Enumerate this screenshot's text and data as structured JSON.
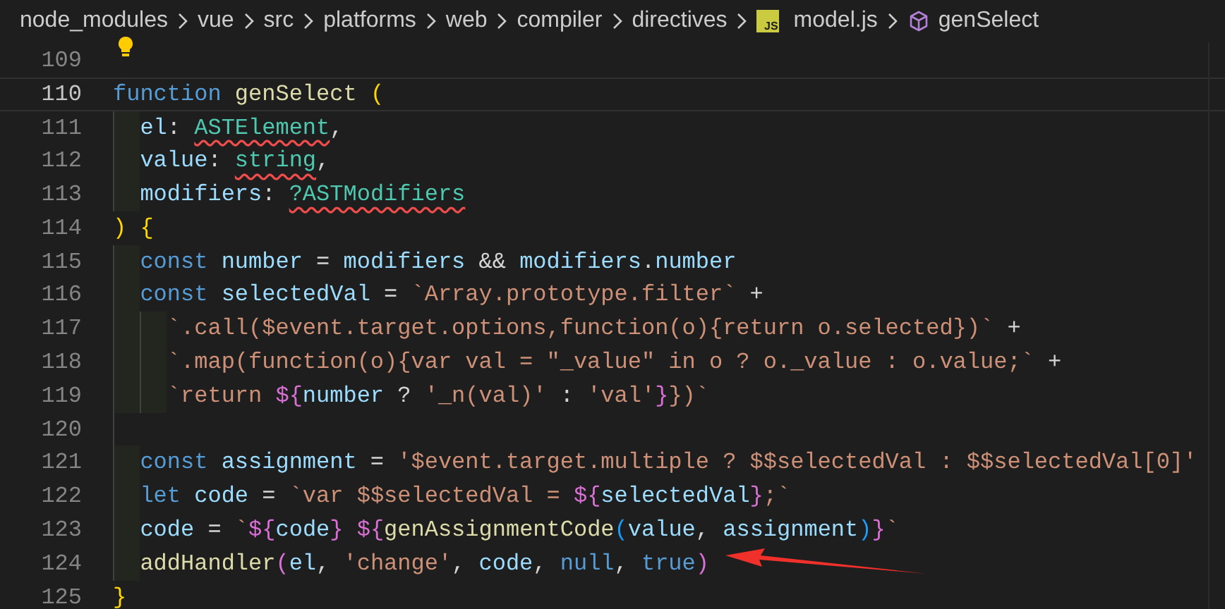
{
  "breadcrumb": [
    {
      "text": "node_modules",
      "kind": "folder"
    },
    {
      "text": "vue",
      "kind": "folder"
    },
    {
      "text": "src",
      "kind": "folder"
    },
    {
      "text": "platforms",
      "kind": "folder"
    },
    {
      "text": "web",
      "kind": "folder"
    },
    {
      "text": "compiler",
      "kind": "folder"
    },
    {
      "text": "directives",
      "kind": "folder"
    },
    {
      "text": "model.js",
      "kind": "file",
      "badge": "JS"
    },
    {
      "text": "genSelect",
      "kind": "symbol"
    }
  ],
  "lines": [
    {
      "number": "109",
      "current": false,
      "lightbulb": true
    },
    {
      "number": "110",
      "current": true,
      "tokens": [
        {
          "text": "function ",
          "kind": "keyword"
        },
        {
          "text": "genSelect ",
          "kind": "function"
        },
        {
          "text": "(",
          "kind": "bracket1"
        }
      ]
    },
    {
      "number": "111",
      "current": false,
      "tokens": [
        {
          "text": "  el",
          "kind": "variable"
        },
        {
          "text": ": ",
          "kind": "plain"
        },
        {
          "text": "ASTElement",
          "kind": "type-error"
        },
        {
          "text": ",",
          "kind": "plain"
        }
      ]
    },
    {
      "number": "112",
      "current": false,
      "tokens": [
        {
          "text": "  value",
          "kind": "variable"
        },
        {
          "text": ": ",
          "kind": "plain"
        },
        {
          "text": "string",
          "kind": "type-error"
        },
        {
          "text": ",",
          "kind": "plain"
        }
      ]
    },
    {
      "number": "113",
      "current": false,
      "tokens": [
        {
          "text": "  modifiers",
          "kind": "variable"
        },
        {
          "text": ": ",
          "kind": "plain"
        },
        {
          "text": "?ASTModifiers",
          "kind": "type-error"
        }
      ]
    },
    {
      "number": "114",
      "current": false,
      "tokens": [
        {
          "text": ") {",
          "kind": "bracket1"
        }
      ]
    },
    {
      "number": "115",
      "current": false,
      "tokens": [
        {
          "text": "  const ",
          "kind": "keyword"
        },
        {
          "text": "number",
          "kind": "variable"
        },
        {
          "text": " = ",
          "kind": "plain"
        },
        {
          "text": "modifiers",
          "kind": "variable"
        },
        {
          "text": " && ",
          "kind": "plain"
        },
        {
          "text": "modifiers",
          "kind": "variable"
        },
        {
          "text": ".",
          "kind": "plain"
        },
        {
          "text": "number",
          "kind": "variable"
        }
      ]
    },
    {
      "number": "116",
      "current": false,
      "tokens": [
        {
          "text": "  const ",
          "kind": "keyword"
        },
        {
          "text": "selectedVal",
          "kind": "variable"
        },
        {
          "text": " = ",
          "kind": "plain"
        },
        {
          "text": "`Array.prototype.filter`",
          "kind": "string"
        },
        {
          "text": " +",
          "kind": "plain"
        }
      ]
    },
    {
      "number": "117",
      "current": false,
      "tokens": [
        {
          "text": "    `.call($event.target.options,function(o){return o.selected})`",
          "kind": "string"
        },
        {
          "text": " +",
          "kind": "plain"
        }
      ]
    },
    {
      "number": "118",
      "current": false,
      "tokens": [
        {
          "text": "    `.map(function(o){var val = \"_value\" in o ? o._value : o.value;`",
          "kind": "string"
        },
        {
          "text": " +",
          "kind": "plain"
        }
      ]
    },
    {
      "number": "119",
      "current": false,
      "tokens": [
        {
          "text": "    `return ",
          "kind": "string"
        },
        {
          "text": "${",
          "kind": "bracket2"
        },
        {
          "text": "number",
          "kind": "variable"
        },
        {
          "text": " ? ",
          "kind": "plain"
        },
        {
          "text": "'_n(val)'",
          "kind": "string"
        },
        {
          "text": " : ",
          "kind": "plain"
        },
        {
          "text": "'val'",
          "kind": "string"
        },
        {
          "text": "}",
          "kind": "bracket2"
        },
        {
          "text": "})`",
          "kind": "string"
        }
      ]
    },
    {
      "number": "120",
      "current": false
    },
    {
      "number": "121",
      "current": false,
      "tokens": [
        {
          "text": "  const ",
          "kind": "keyword"
        },
        {
          "text": "assignment",
          "kind": "variable"
        },
        {
          "text": " = ",
          "kind": "plain"
        },
        {
          "text": "'$event.target.multiple ? $$selectedVal : $$selectedVal[0]'",
          "kind": "string"
        }
      ]
    },
    {
      "number": "122",
      "current": false,
      "tokens": [
        {
          "text": "  let ",
          "kind": "keyword"
        },
        {
          "text": "code",
          "kind": "variable"
        },
        {
          "text": " = ",
          "kind": "plain"
        },
        {
          "text": "`var $$selectedVal = ",
          "kind": "string"
        },
        {
          "text": "${",
          "kind": "bracket2"
        },
        {
          "text": "selectedVal",
          "kind": "variable"
        },
        {
          "text": "}",
          "kind": "bracket2"
        },
        {
          "text": ";`",
          "kind": "string"
        }
      ]
    },
    {
      "number": "123",
      "current": false,
      "tokens": [
        {
          "text": "  code",
          "kind": "variable"
        },
        {
          "text": " = ",
          "kind": "plain"
        },
        {
          "text": "`",
          "kind": "string"
        },
        {
          "text": "${",
          "kind": "bracket2"
        },
        {
          "text": "code",
          "kind": "variable"
        },
        {
          "text": "} ${",
          "kind": "bracket2"
        },
        {
          "text": "genAssignmentCode",
          "kind": "function"
        },
        {
          "text": "(",
          "kind": "bracket3"
        },
        {
          "text": "value",
          "kind": "variable"
        },
        {
          "text": ", ",
          "kind": "plain"
        },
        {
          "text": "assignment",
          "kind": "variable"
        },
        {
          "text": ")",
          "kind": "bracket3"
        },
        {
          "text": "}",
          "kind": "bracket2"
        },
        {
          "text": "`",
          "kind": "string"
        }
      ]
    },
    {
      "number": "124",
      "current": false,
      "tokens": [
        {
          "text": "  addHandler",
          "kind": "function"
        },
        {
          "text": "(",
          "kind": "bracket2"
        },
        {
          "text": "el",
          "kind": "variable"
        },
        {
          "text": ", ",
          "kind": "plain"
        },
        {
          "text": "'change'",
          "kind": "string"
        },
        {
          "text": ", ",
          "kind": "plain"
        },
        {
          "text": "code",
          "kind": "variable"
        },
        {
          "text": ", ",
          "kind": "plain"
        },
        {
          "text": "null",
          "kind": "keyword"
        },
        {
          "text": ", ",
          "kind": "plain"
        },
        {
          "text": "true",
          "kind": "keyword"
        },
        {
          "text": ")",
          "kind": "bracket2"
        }
      ]
    },
    {
      "number": "125",
      "current": false,
      "tokens": [
        {
          "text": "}",
          "kind": "bracket1"
        }
      ]
    }
  ]
}
